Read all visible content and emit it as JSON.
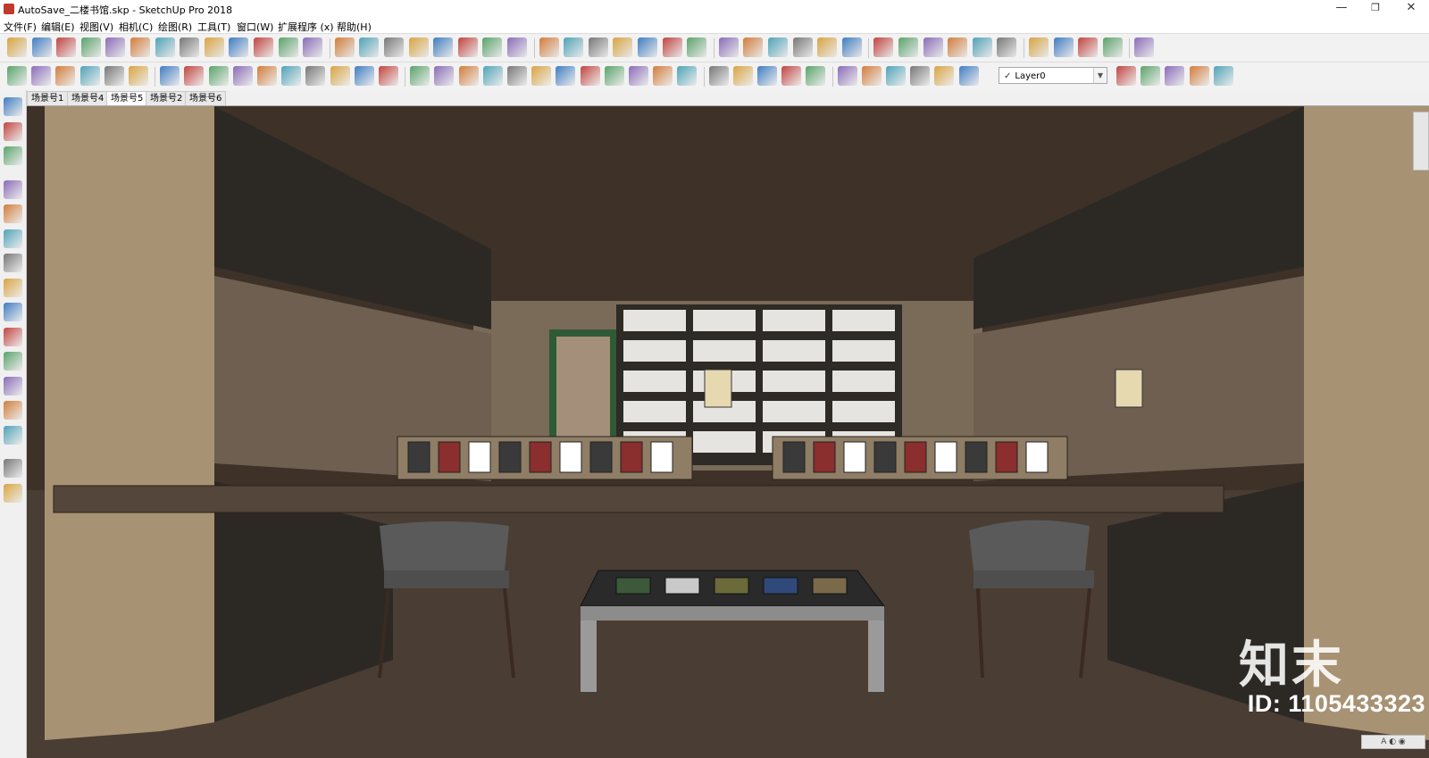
{
  "window": {
    "title": "AutoSave_二楼书馆.skp - SketchUp Pro 2018",
    "min_glyph": "—",
    "max_glyph": "❐",
    "close_glyph": "✕"
  },
  "menu": {
    "items": [
      "文件(F)",
      "编辑(E)",
      "视图(V)",
      "相机(C)",
      "绘图(R)",
      "工具(T)",
      "窗口(W)",
      "扩展程序 (x)",
      "帮助(H)"
    ]
  },
  "toolbar": {
    "icons1": [
      "select-icon",
      "eraser-icon",
      "pencil-icon",
      "arc-icon",
      "rectangle-icon",
      "push-pull-icon",
      "follow-me-icon",
      "move-icon",
      "rotate-icon",
      "scale-icon",
      "tape-measure-icon",
      "text-icon",
      "paint-bucket-icon",
      "orbit-icon",
      "pan-icon",
      "zoom-icon",
      "zoom-extents-icon",
      "warehouse-icon",
      "components-icon",
      "extension-warehouse-icon",
      "layout-icon",
      "shield-icon",
      "refresh-icon",
      "print-icon",
      "camera-icon",
      "photo-icon",
      "scene-icon",
      "tree-icon",
      "settings-icon",
      "sound-icon",
      "sliders-icon",
      "sliders-alt-icon",
      "chat-icon",
      "info-icon",
      "layers-icon",
      "layers-alt-icon",
      "doc-icon",
      "doc-alt-icon",
      "grid-icon",
      "grid-alt-icon",
      "grid-2-icon",
      "grid-3-icon",
      "grid-4-icon",
      "grid-5-icon",
      "globe-icon"
    ],
    "icons2": [
      "tool-a-icon",
      "tool-b-icon",
      "tool-c-icon",
      "tool-d-icon",
      "tool-e-icon",
      "tool-f-icon",
      "tool-g-icon",
      "tool-h-icon",
      "tool-i-icon",
      "tool-j-icon",
      "tool-k-icon",
      "tool-l-icon",
      "tool-m-icon",
      "tool-n-icon",
      "tool-o-icon",
      "tool-p-icon",
      "tool-q-icon",
      "tool-r-icon",
      "tool-s-icon",
      "tool-t-icon",
      "tool-u-icon",
      "tool-v-icon",
      "tool-w-icon",
      "tool-x-icon",
      "tool-y-icon",
      "tool-z-icon",
      "tool-aa-icon",
      "tool-ab-icon",
      "tool-ac-icon",
      "tool-ad-icon",
      "tool-ae-icon",
      "tool-af-icon",
      "tool-ag-icon",
      "tool-ah-icon",
      "tool-ai-icon",
      "tool-aj-icon",
      "tool-ak-icon",
      "tool-al-icon",
      "tool-am-icon",
      "tool-an-icon",
      "tool-ao-icon",
      "tool-ap-icon",
      "tool-aq-icon",
      "tool-ar-icon"
    ],
    "layer": "Layer0"
  },
  "scenes": {
    "tabs": [
      "场景号1",
      "场景号4",
      "场景号5",
      "场景号2",
      "场景号6"
    ],
    "active_index": 2
  },
  "left_palette": {
    "icons": [
      "box-view-icon",
      "box-front-icon",
      "box-side-icon",
      "sandbox-a-icon",
      "sandbox-b-icon",
      "sandbox-c-icon",
      "sandbox-d-icon",
      "sandbox-e-icon",
      "sandbox-f-icon",
      "sandbox-g-icon",
      "section-icon",
      "section-alt-icon",
      "solid-a-icon",
      "solid-b-icon",
      "solid-c-icon",
      "solid-d-icon"
    ]
  },
  "viewport": {
    "watermark_logo": "知末",
    "watermark_id": "ID: 1105433323",
    "status_glyph": "A ◐ ◉"
  },
  "colors": {
    "ceiling": "#3e3128",
    "floor": "#4a3d33",
    "wood": "#a89274",
    "shelf_dark": "#2c2925",
    "window_bg": "#f0f0f0"
  }
}
